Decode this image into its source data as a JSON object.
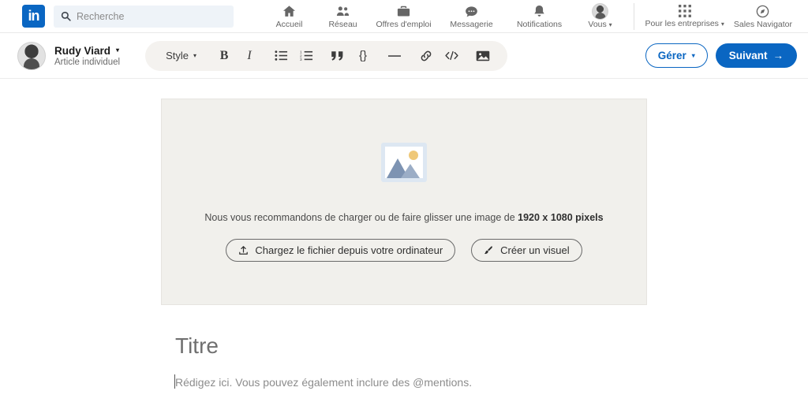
{
  "colors": {
    "brand": "#0a66c2",
    "nav_text": "#666666",
    "search_bg": "#eef3f8",
    "toolbar_bg": "#f4f2ef",
    "cover_bg": "#f1f0ec"
  },
  "global_nav": {
    "logo_text": "in",
    "logo_name": "linkedin-logo",
    "search": {
      "placeholder": "Recherche",
      "value": "",
      "icon": "search-icon"
    },
    "items": [
      {
        "label": "Accueil",
        "icon": "home-icon"
      },
      {
        "label": "Réseau",
        "icon": "network-icon"
      },
      {
        "label": "Offres d'emploi",
        "icon": "briefcase-icon"
      },
      {
        "label": "Messagerie",
        "icon": "message-icon"
      },
      {
        "label": "Notifications",
        "icon": "bell-icon"
      },
      {
        "label": "Vous",
        "icon": "avatar-icon",
        "caret": "▾"
      }
    ],
    "business": [
      {
        "label": "Pour les entreprises",
        "icon": "grid-icon",
        "caret": "▾"
      },
      {
        "label": "Sales Navigator",
        "icon": "compass-icon"
      }
    ]
  },
  "editor": {
    "author": {
      "name": "Rudy Viard",
      "caret": "▾",
      "subtitle": "Article individuel",
      "avatar": "author-avatar"
    },
    "toolbar": {
      "style_label": "Style",
      "style_caret": "▾",
      "tools": [
        {
          "name": "bold-icon",
          "glyph": "B"
        },
        {
          "name": "italic-icon",
          "glyph": "I"
        },
        {
          "name": "bulleted-list-icon",
          "glyph": ""
        },
        {
          "name": "numbered-list-icon",
          "glyph": ""
        },
        {
          "name": "quote-icon",
          "glyph": "””"
        },
        {
          "name": "code-block-icon",
          "glyph": "{}"
        },
        {
          "name": "horizontal-rule-icon",
          "glyph": "—"
        },
        {
          "name": "link-icon",
          "glyph": ""
        },
        {
          "name": "inline-code-icon",
          "glyph": "</>"
        },
        {
          "name": "image-icon",
          "glyph": ""
        }
      ]
    },
    "actions": {
      "manage_label": "Gérer",
      "manage_caret": "▾",
      "next_label": "Suivant",
      "next_arrow": "→"
    }
  },
  "cover": {
    "placeholder_icon": "image-placeholder-icon",
    "hint_prefix": "Nous vous recommandons de charger ou de faire glisser une image de ",
    "hint_dimensions": "1920 x 1080 pixels",
    "upload_button": {
      "label": "Chargez le fichier depuis votre ordinateur",
      "icon": "upload-icon"
    },
    "create_button": {
      "label": "Créer un visuel",
      "icon": "design-brush-icon"
    }
  },
  "article": {
    "title_placeholder": "Titre",
    "body_placeholder": "Rédigez ici. Vous pouvez également inclure des @mentions."
  }
}
